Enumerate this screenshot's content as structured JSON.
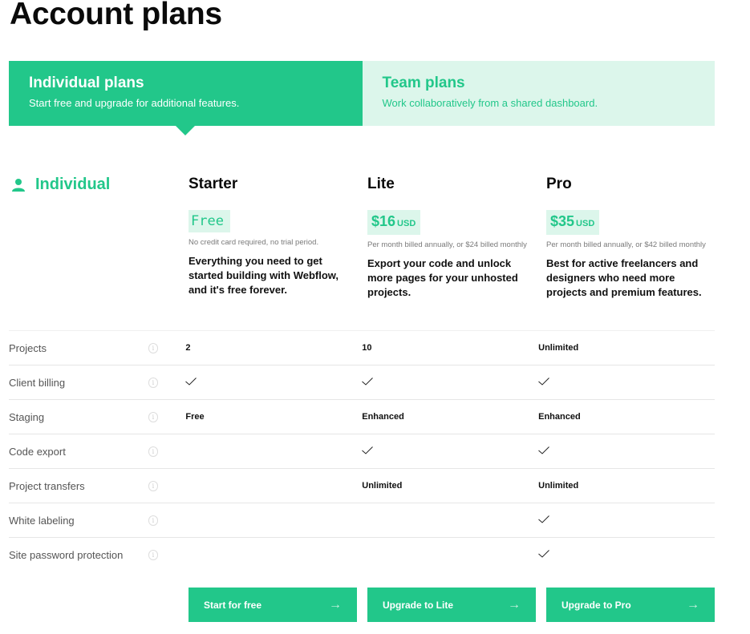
{
  "page": {
    "title": "Account plans"
  },
  "colors": {
    "accent": "#22c78a",
    "accent_light": "#dcf6eb"
  },
  "tabs": [
    {
      "title": "Individual plans",
      "subtitle": "Start free and upgrade for additional features.",
      "active": true
    },
    {
      "title": "Team plans",
      "subtitle": "Work collaboratively from a shared dashboard.",
      "active": false
    }
  ],
  "section": {
    "label": "Individual",
    "icon": "user-icon"
  },
  "plans": [
    {
      "name": "Starter",
      "price": "Free",
      "currency": "",
      "billing": "No credit card required, no trial period.",
      "description": "Everything you need to get started building with Webflow, and it's free forever.",
      "cta": "Start for free"
    },
    {
      "name": "Lite",
      "price": "$16",
      "currency": "USD",
      "billing": "Per month billed annually, or $24 billed monthly",
      "description": "Export your code and unlock more pages for your unhosted projects.",
      "cta": "Upgrade to Lite"
    },
    {
      "name": "Pro",
      "price": "$35",
      "currency": "USD",
      "billing": "Per month billed annually, or $42 billed monthly",
      "description": "Best for active freelancers and designers who need more projects and premium features.",
      "cta": "Upgrade to Pro"
    }
  ],
  "features": [
    {
      "name": "Projects",
      "values": [
        "2",
        "10",
        "Unlimited"
      ]
    },
    {
      "name": "Client billing",
      "values": [
        "check",
        "check",
        "check"
      ]
    },
    {
      "name": "Staging",
      "values": [
        "Free",
        "Enhanced",
        "Enhanced"
      ]
    },
    {
      "name": "Code export",
      "values": [
        "",
        "check",
        "check"
      ]
    },
    {
      "name": "Project transfers",
      "values": [
        "",
        "Unlimited",
        "Unlimited"
      ]
    },
    {
      "name": "White labeling",
      "values": [
        "",
        "",
        "check"
      ]
    },
    {
      "name": "Site password protection",
      "values": [
        "",
        "",
        "check"
      ]
    }
  ],
  "icons": {
    "info": "i",
    "arrow": "→"
  }
}
